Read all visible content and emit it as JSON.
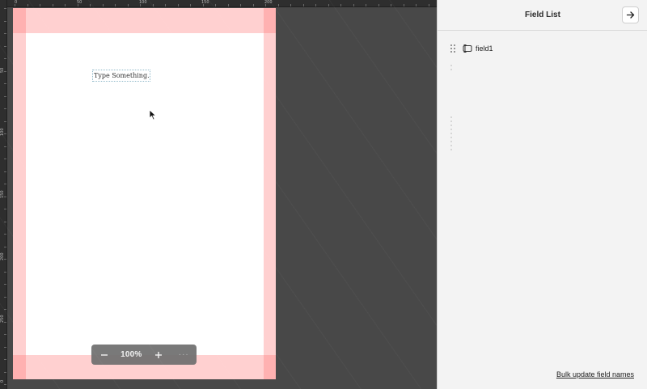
{
  "editor": {
    "text_field_placeholder": "Type Something...",
    "bleed_color": "#ff7878",
    "ruler": {
      "top_ticks": [
        "0",
        "50",
        "100",
        "150",
        "200"
      ],
      "left_ticks": [
        "50",
        "100",
        "150",
        "200",
        "250",
        "0"
      ]
    }
  },
  "zoom": {
    "level": "100%",
    "zoom_out_icon": "minus-icon",
    "zoom_in_icon": "plus-icon",
    "more": "···"
  },
  "panel": {
    "title": "Field List",
    "collapse_icon": "arrow-right-icon",
    "fields": [
      {
        "name": "field1",
        "icon": "text-field-icon"
      }
    ],
    "bulk_update_label": "Bulk update field names"
  }
}
